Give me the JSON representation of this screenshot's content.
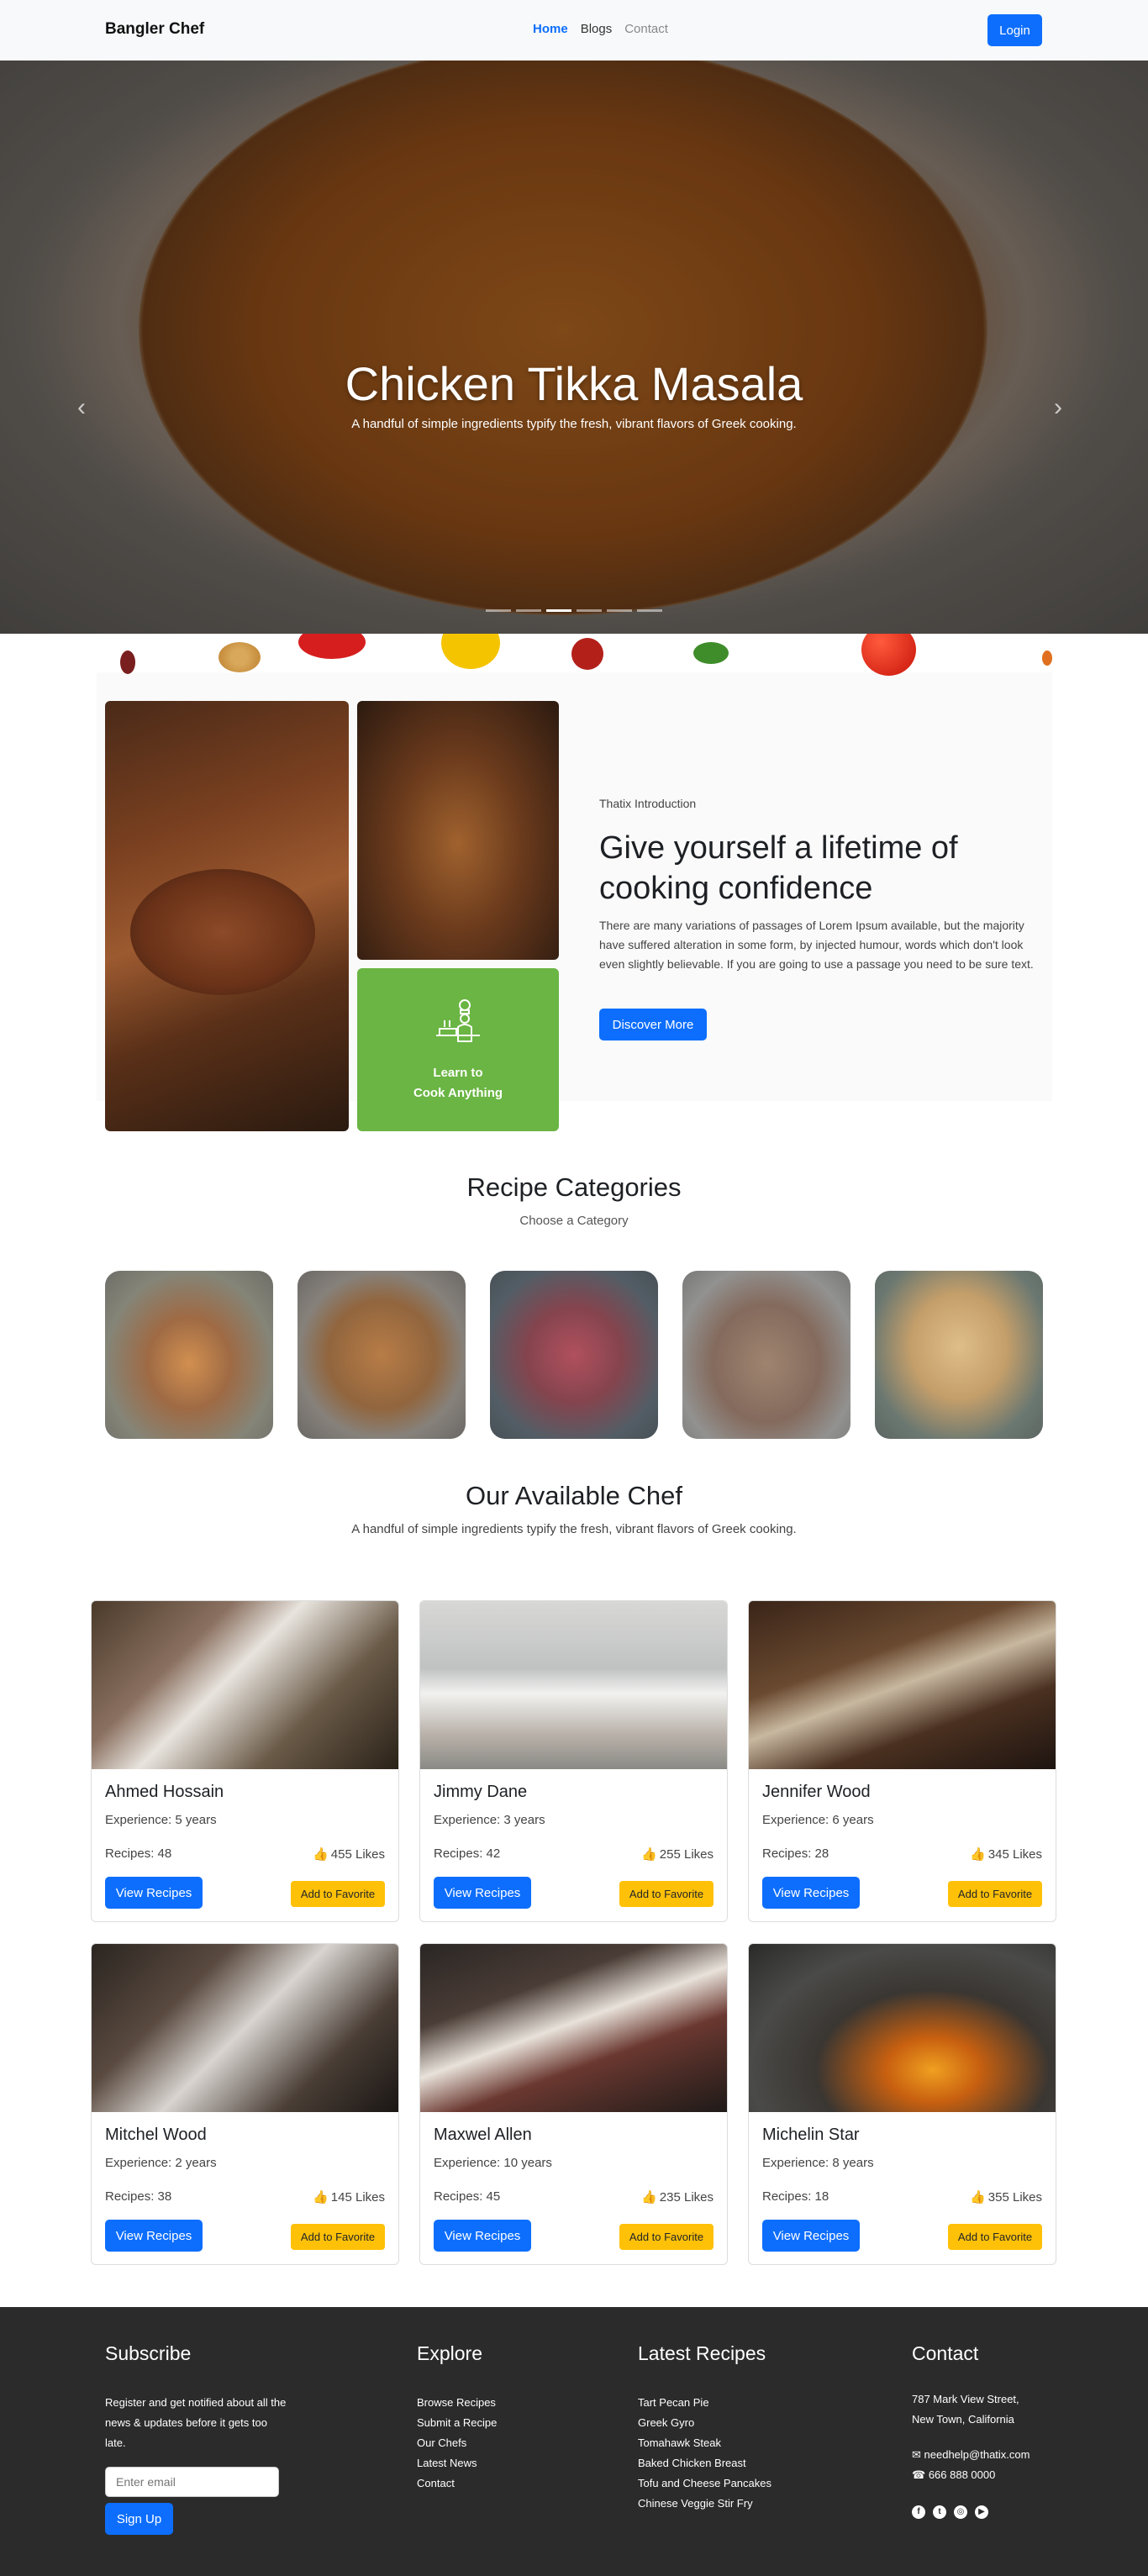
{
  "navbar": {
    "brand": "Bangler Chef",
    "links": {
      "home": "Home",
      "blogs": "Blogs",
      "contact": "Contact"
    },
    "login_label": "Login",
    "active_link_color": "#0d6efd"
  },
  "hero": {
    "title": "Chicken Tikka Masala",
    "subtitle": "A handful of simple ingredients typify the fresh, vibrant flavors of Greek cooking.",
    "prev_icon": "chevron-left-icon",
    "next_icon": "chevron-right-icon",
    "slide_count": 6,
    "active_slide": 3
  },
  "intro": {
    "card_line1": "Learn to",
    "card_line2": "Cook Anything",
    "kicker": "Thatix Introduction",
    "heading": "Give yourself a lifetime of cooking confidence",
    "text": "There are many variations of passages of Lorem Ipsum available, but the majority have suffered alteration in some form, by injected humour, words which don't look even slightly believable. If you are going to use a passage you need to be sure text.",
    "button_label": "Discover More",
    "accent_green": "#6ab543"
  },
  "categories": {
    "title": "Recipe Categories",
    "subtitle": "Choose a Category"
  },
  "chefs": {
    "title": "Our Available Chef",
    "subtitle": "A handful of simple ingredients typify the fresh, vibrant flavors of Greek cooking.",
    "recipes_prefix": "Recipes: ",
    "view_label": "View Recipes",
    "fav_label": "Add to Favorite",
    "items": [
      {
        "name": "Ahmed Hossain",
        "experience": "Experience: 5 years",
        "recipes": "Recipes: 48",
        "likes": "455 Likes"
      },
      {
        "name": "Jimmy Dane",
        "experience": "Experience: 3 years",
        "recipes": "Recipes: 42",
        "likes": "255 Likes"
      },
      {
        "name": "Jennifer Wood",
        "experience": "Experience: 6 years",
        "recipes": "Recipes: 28",
        "likes": "345 Likes"
      },
      {
        "name": "Mitchel Wood",
        "experience": "Experience: 2 years",
        "recipes": "Recipes: 38",
        "likes": "145 Likes"
      },
      {
        "name": "Maxwel Allen",
        "experience": "Experience: 10 years",
        "recipes": "Recipes: 45",
        "likes": "235 Likes"
      },
      {
        "name": "Michelin Star",
        "experience": "Experience: 8 years",
        "recipes": "Recipes: 18",
        "likes": "355 Likes"
      }
    ]
  },
  "footer": {
    "subscribe": {
      "title": "Subscribe",
      "text": "Register and get notified about all the news & updates before it gets too late.",
      "email_placeholder": "Enter email",
      "button_label": "Sign Up"
    },
    "explore": {
      "title": "Explore",
      "items": [
        "Browse Recipes",
        "Submit a Recipe",
        "Our Chefs",
        "Latest News",
        "Contact"
      ]
    },
    "latest": {
      "title": "Latest Recipes",
      "items": [
        "Tart Pecan Pie",
        "Greek Gyro",
        "Tomahawk Steak",
        "Baked Chicken Breast",
        "Tofu and Cheese Pancakes",
        "Chinese Veggie Stir Fry"
      ]
    },
    "contact": {
      "title": "Contact",
      "address_line1": "787 Mark View Street,",
      "address_line2": "New Town, California",
      "email": "needhelp@thatix.com",
      "phone": "666 888 0000",
      "social_icons": [
        "facebook-icon",
        "twitter-icon",
        "instagram-icon",
        "youtube-icon"
      ]
    },
    "background": "#2b2b2b"
  }
}
